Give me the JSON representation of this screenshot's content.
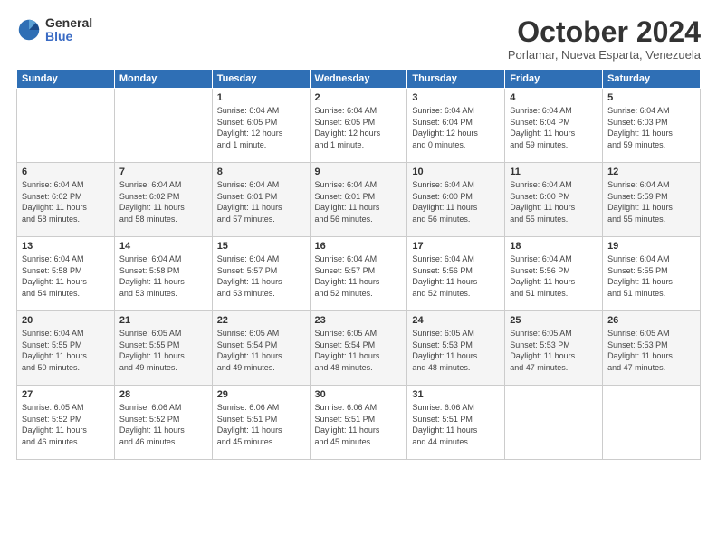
{
  "logo": {
    "general": "General",
    "blue": "Blue",
    "icon": "▶"
  },
  "title": "October 2024",
  "subtitle": "Porlamar, Nueva Esparta, Venezuela",
  "headers": [
    "Sunday",
    "Monday",
    "Tuesday",
    "Wednesday",
    "Thursday",
    "Friday",
    "Saturday"
  ],
  "weeks": [
    [
      {
        "day": "",
        "info": ""
      },
      {
        "day": "",
        "info": ""
      },
      {
        "day": "1",
        "info": "Sunrise: 6:04 AM\nSunset: 6:05 PM\nDaylight: 12 hours\nand 1 minute."
      },
      {
        "day": "2",
        "info": "Sunrise: 6:04 AM\nSunset: 6:05 PM\nDaylight: 12 hours\nand 1 minute."
      },
      {
        "day": "3",
        "info": "Sunrise: 6:04 AM\nSunset: 6:04 PM\nDaylight: 12 hours\nand 0 minutes."
      },
      {
        "day": "4",
        "info": "Sunrise: 6:04 AM\nSunset: 6:04 PM\nDaylight: 11 hours\nand 59 minutes."
      },
      {
        "day": "5",
        "info": "Sunrise: 6:04 AM\nSunset: 6:03 PM\nDaylight: 11 hours\nand 59 minutes."
      }
    ],
    [
      {
        "day": "6",
        "info": "Sunrise: 6:04 AM\nSunset: 6:02 PM\nDaylight: 11 hours\nand 58 minutes."
      },
      {
        "day": "7",
        "info": "Sunrise: 6:04 AM\nSunset: 6:02 PM\nDaylight: 11 hours\nand 58 minutes."
      },
      {
        "day": "8",
        "info": "Sunrise: 6:04 AM\nSunset: 6:01 PM\nDaylight: 11 hours\nand 57 minutes."
      },
      {
        "day": "9",
        "info": "Sunrise: 6:04 AM\nSunset: 6:01 PM\nDaylight: 11 hours\nand 56 minutes."
      },
      {
        "day": "10",
        "info": "Sunrise: 6:04 AM\nSunset: 6:00 PM\nDaylight: 11 hours\nand 56 minutes."
      },
      {
        "day": "11",
        "info": "Sunrise: 6:04 AM\nSunset: 6:00 PM\nDaylight: 11 hours\nand 55 minutes."
      },
      {
        "day": "12",
        "info": "Sunrise: 6:04 AM\nSunset: 5:59 PM\nDaylight: 11 hours\nand 55 minutes."
      }
    ],
    [
      {
        "day": "13",
        "info": "Sunrise: 6:04 AM\nSunset: 5:58 PM\nDaylight: 11 hours\nand 54 minutes."
      },
      {
        "day": "14",
        "info": "Sunrise: 6:04 AM\nSunset: 5:58 PM\nDaylight: 11 hours\nand 53 minutes."
      },
      {
        "day": "15",
        "info": "Sunrise: 6:04 AM\nSunset: 5:57 PM\nDaylight: 11 hours\nand 53 minutes."
      },
      {
        "day": "16",
        "info": "Sunrise: 6:04 AM\nSunset: 5:57 PM\nDaylight: 11 hours\nand 52 minutes."
      },
      {
        "day": "17",
        "info": "Sunrise: 6:04 AM\nSunset: 5:56 PM\nDaylight: 11 hours\nand 52 minutes."
      },
      {
        "day": "18",
        "info": "Sunrise: 6:04 AM\nSunset: 5:56 PM\nDaylight: 11 hours\nand 51 minutes."
      },
      {
        "day": "19",
        "info": "Sunrise: 6:04 AM\nSunset: 5:55 PM\nDaylight: 11 hours\nand 51 minutes."
      }
    ],
    [
      {
        "day": "20",
        "info": "Sunrise: 6:04 AM\nSunset: 5:55 PM\nDaylight: 11 hours\nand 50 minutes."
      },
      {
        "day": "21",
        "info": "Sunrise: 6:05 AM\nSunset: 5:55 PM\nDaylight: 11 hours\nand 49 minutes."
      },
      {
        "day": "22",
        "info": "Sunrise: 6:05 AM\nSunset: 5:54 PM\nDaylight: 11 hours\nand 49 minutes."
      },
      {
        "day": "23",
        "info": "Sunrise: 6:05 AM\nSunset: 5:54 PM\nDaylight: 11 hours\nand 48 minutes."
      },
      {
        "day": "24",
        "info": "Sunrise: 6:05 AM\nSunset: 5:53 PM\nDaylight: 11 hours\nand 48 minutes."
      },
      {
        "day": "25",
        "info": "Sunrise: 6:05 AM\nSunset: 5:53 PM\nDaylight: 11 hours\nand 47 minutes."
      },
      {
        "day": "26",
        "info": "Sunrise: 6:05 AM\nSunset: 5:53 PM\nDaylight: 11 hours\nand 47 minutes."
      }
    ],
    [
      {
        "day": "27",
        "info": "Sunrise: 6:05 AM\nSunset: 5:52 PM\nDaylight: 11 hours\nand 46 minutes."
      },
      {
        "day": "28",
        "info": "Sunrise: 6:06 AM\nSunset: 5:52 PM\nDaylight: 11 hours\nand 46 minutes."
      },
      {
        "day": "29",
        "info": "Sunrise: 6:06 AM\nSunset: 5:51 PM\nDaylight: 11 hours\nand 45 minutes."
      },
      {
        "day": "30",
        "info": "Sunrise: 6:06 AM\nSunset: 5:51 PM\nDaylight: 11 hours\nand 45 minutes."
      },
      {
        "day": "31",
        "info": "Sunrise: 6:06 AM\nSunset: 5:51 PM\nDaylight: 11 hours\nand 44 minutes."
      },
      {
        "day": "",
        "info": ""
      },
      {
        "day": "",
        "info": ""
      }
    ]
  ]
}
